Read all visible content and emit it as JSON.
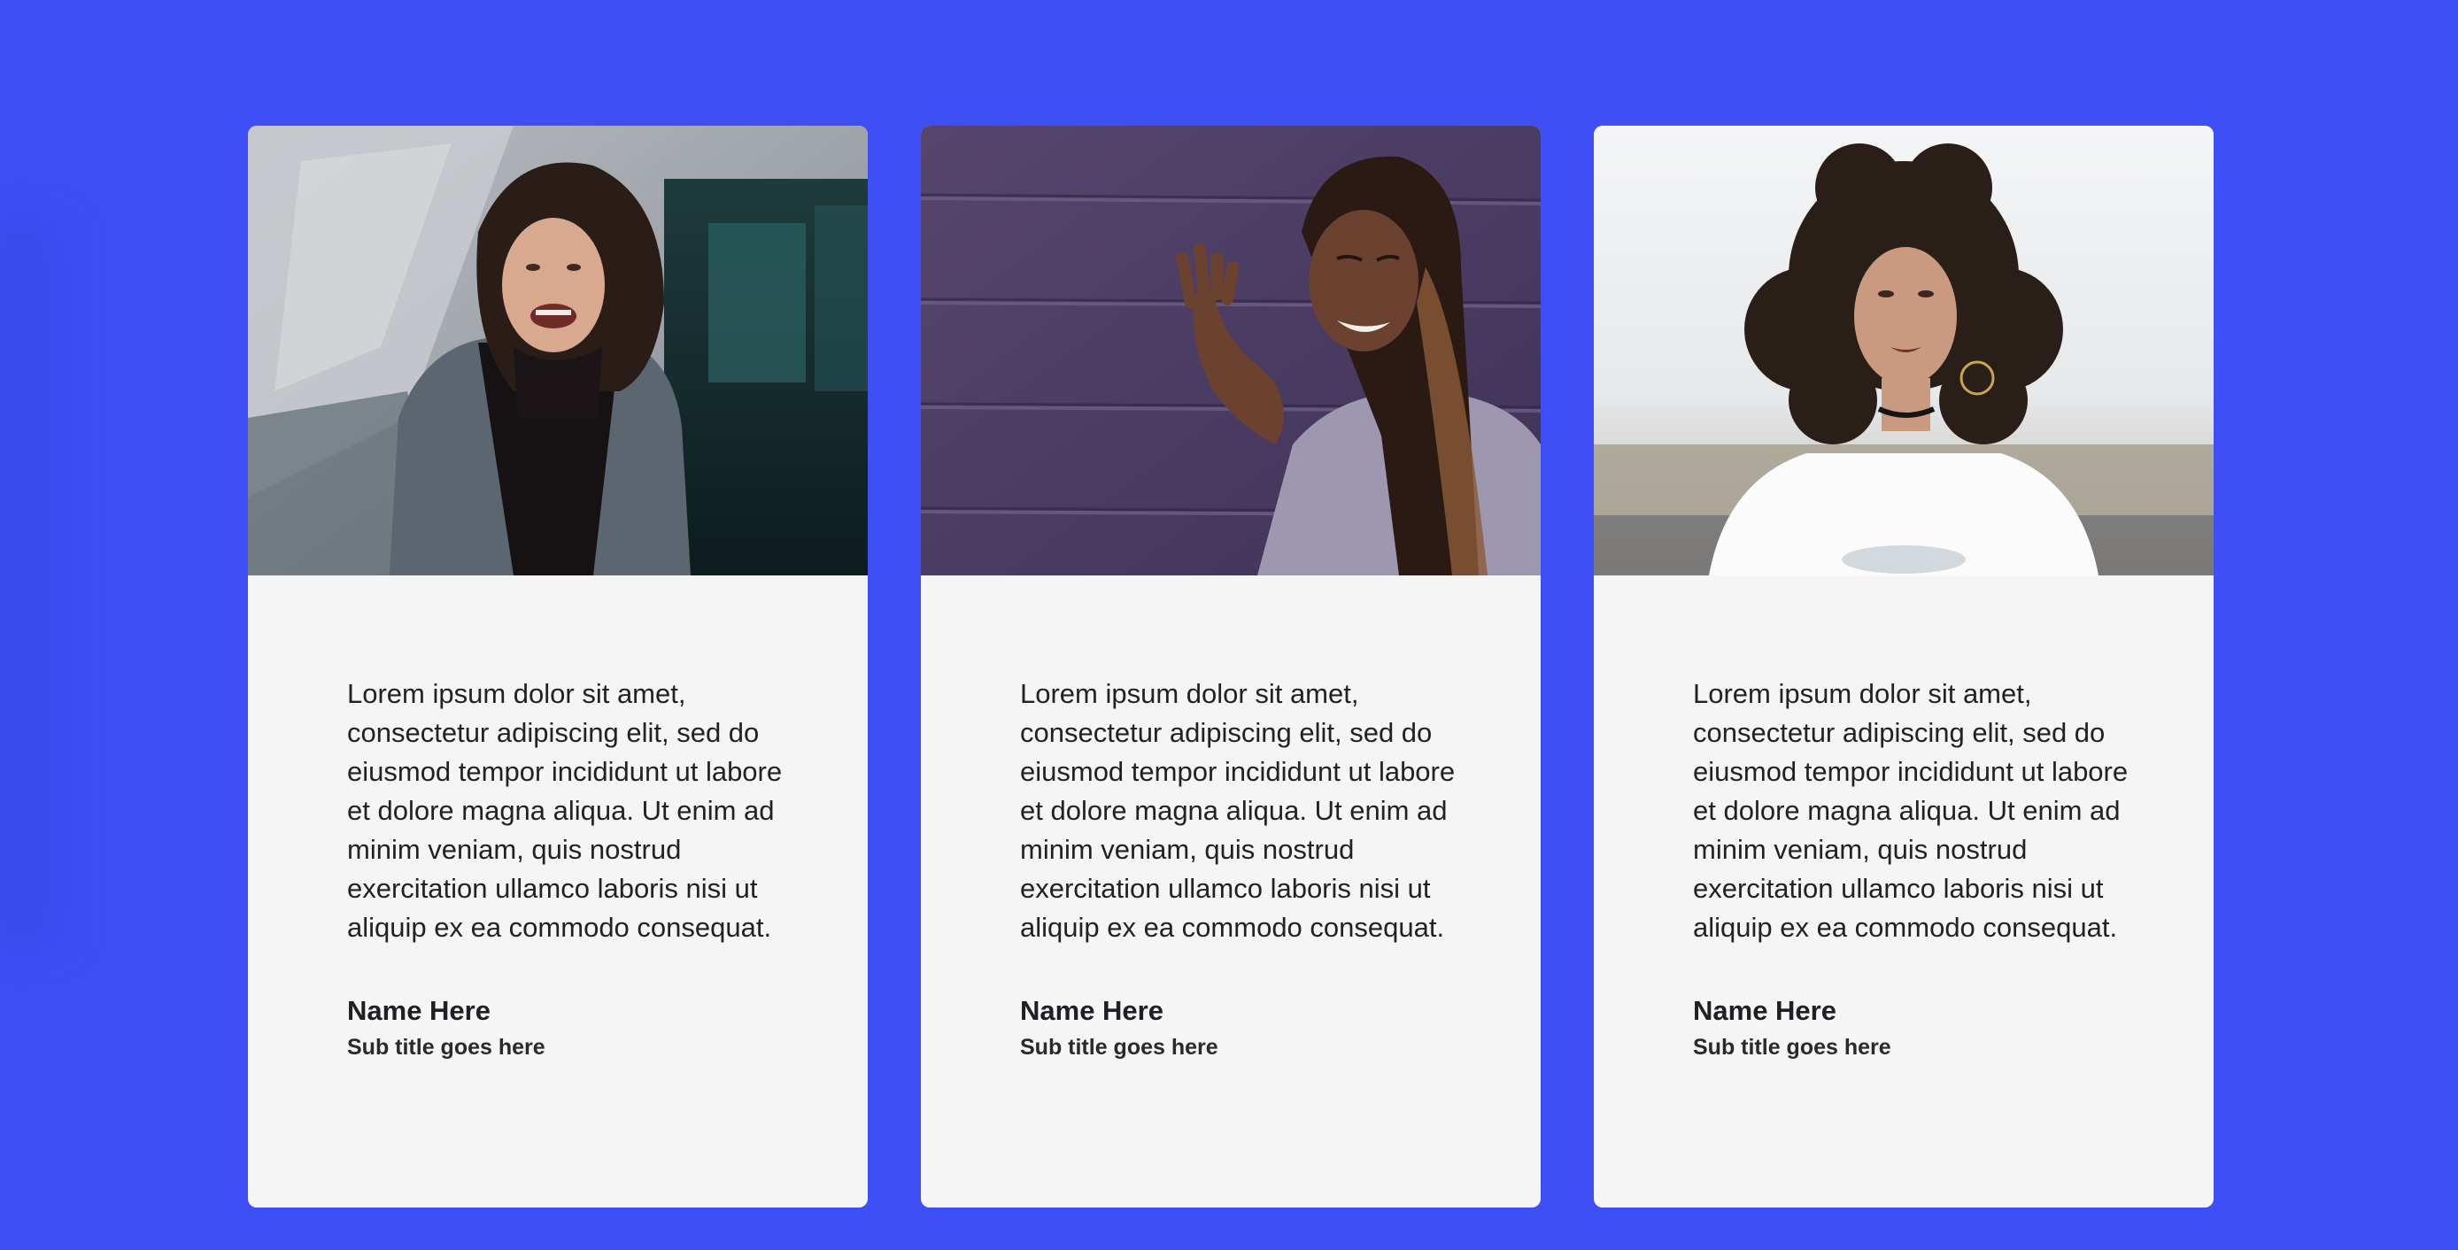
{
  "colors": {
    "background": "#3d4ff5",
    "card": "#f5f5f5",
    "text": "#222226"
  },
  "testimonials": [
    {
      "photo": "portrait-photo-woman-denim-jacket",
      "quote": "Lorem ipsum dolor sit amet, consectetur adipiscing elit, sed do eiusmod tempor incididunt ut labore et dolore magna aliqua. Ut enim ad minim veniam, quis nostrud exercitation ullamco laboris nisi ut aliquip ex ea commodo consequat.",
      "name": "Name Here",
      "subtitle": "Sub title goes here"
    },
    {
      "photo": "portrait-photo-woman-purple-wall",
      "quote": "Lorem ipsum dolor sit amet, consectetur adipiscing elit, sed do eiusmod tempor incididunt ut labore et dolore magna aliqua. Ut enim ad minim veniam, quis nostrud exercitation ullamco laboris nisi ut aliquip ex ea commodo consequat.",
      "name": "Name Here",
      "subtitle": "Sub title goes here"
    },
    {
      "photo": "portrait-photo-woman-curly-hair",
      "quote": "Lorem ipsum dolor sit amet, consectetur adipiscing elit, sed do eiusmod tempor incididunt ut labore et dolore magna aliqua. Ut enim ad minim veniam, quis nostrud exercitation ullamco laboris nisi ut aliquip ex ea commodo consequat.",
      "name": "Name Here",
      "subtitle": "Sub title goes here"
    }
  ]
}
